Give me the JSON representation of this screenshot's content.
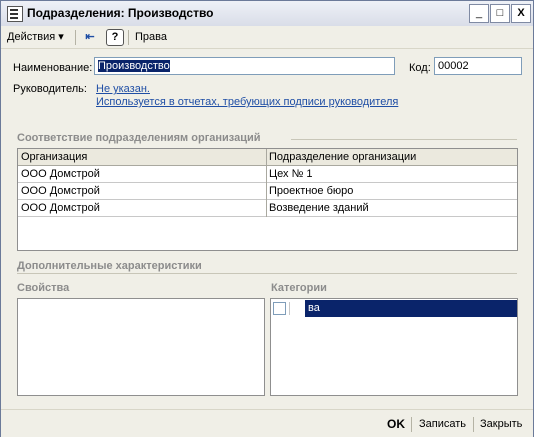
{
  "window": {
    "title": "Подразделения: Производство",
    "controls": {
      "minimize": "_",
      "maximize": "□",
      "close": "X"
    }
  },
  "toolbar": {
    "actions_label": "Действия",
    "help_label": "?",
    "rights_label": "Права"
  },
  "form": {
    "name_label": "Наименование:",
    "name_value": "Производство",
    "code_label": "Код:",
    "code_value": "00002",
    "manager_label": "Руководитель:",
    "manager_link": "Не указан.",
    "manager_note": "Используется в отчетах, требующих подписи руководителя"
  },
  "mapping": {
    "section_title": "Соответствие подразделениям организаций",
    "columns": [
      "Организация",
      "Подразделение организации"
    ],
    "rows": [
      [
        "ООО Домстрой",
        "Цех № 1"
      ],
      [
        "ООО Домстрой",
        "Проектное бюро"
      ],
      [
        "ООО Домстрой",
        "Возведение зданий"
      ]
    ]
  },
  "extra": {
    "section_title": "Дополнительные характеристики",
    "properties_label": "Свойства",
    "categories_label": "Категории",
    "categories": [
      {
        "checked": false,
        "text": "ва"
      }
    ]
  },
  "footer": {
    "ok_label": "OK",
    "save_label": "Записать",
    "close_label": "Закрыть"
  },
  "colors": {
    "accent": "#0a246a",
    "link": "#1f4ea5"
  }
}
